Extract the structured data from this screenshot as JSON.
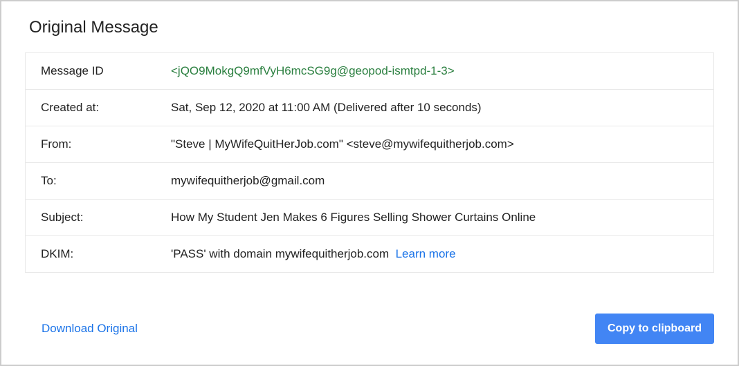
{
  "title": "Original Message",
  "rows": {
    "message_id": {
      "label": "Message ID",
      "value": "<jQO9MokgQ9mfVyH6mcSG9g@geopod-ismtpd-1-3>"
    },
    "created_at": {
      "label": "Created at:",
      "value": "Sat, Sep 12, 2020 at 11:00 AM (Delivered after 10 seconds)"
    },
    "from": {
      "label": "From:",
      "value": "\"Steve | MyWifeQuitHerJob.com\" <steve@mywifequitherjob.com>"
    },
    "to": {
      "label": "To:",
      "value": "mywifequitherjob@gmail.com"
    },
    "subject": {
      "label": "Subject:",
      "value": "How My Student Jen Makes 6 Figures Selling Shower Curtains Online"
    },
    "dkim": {
      "label": "DKIM:",
      "value": "'PASS' with domain mywifequitherjob.com",
      "link_text": "Learn more"
    }
  },
  "actions": {
    "download": "Download Original",
    "copy": "Copy to clipboard"
  }
}
